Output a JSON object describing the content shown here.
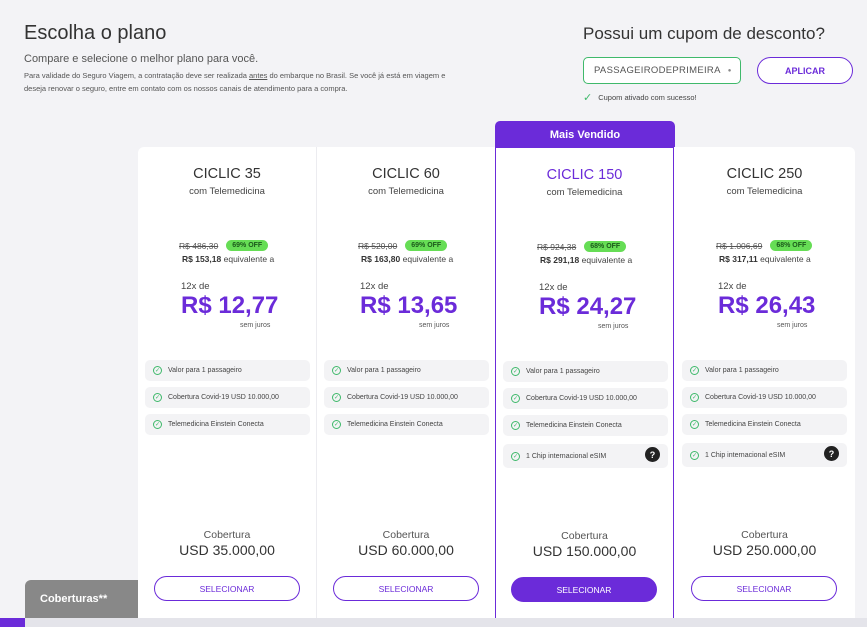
{
  "header": {
    "title": "Escolha o plano",
    "subtitle": "Compare e selecione o melhor plano para você.",
    "notice_pre": "Para validade do Seguro Viagem, a contratação deve ser realizada ",
    "notice_underlined": "antes",
    "notice_post": " do embarque no Brasil. Se você já está em viagem e deseja renovar o seguro, entre em contato com os nossos canais de atendimento para a compra."
  },
  "coupon": {
    "title": "Possui um cupom de desconto?",
    "code": "PASSAGEIRODEPRIMEIRA",
    "apply_label": "APLICAR",
    "success_text": "Cupom ativado com sucesso!"
  },
  "badge": "Mais Vendido",
  "plans": [
    {
      "name": "CICLIC 35",
      "sub": "com Telemedicina",
      "old_price": "R$ 486,30",
      "off": "69% OFF",
      "total": "R$ 153,18",
      "equiv": "equivalente a",
      "installments": "12x de",
      "installment_value": "R$ 12,77",
      "no_interest": "sem juros",
      "features": [
        "Valor para 1 passageiro",
        "Cobertura Covid-19 USD 10.000,00",
        "Telemedicina Einstein Conecta"
      ],
      "coverage_label": "Cobertura",
      "coverage_value": "USD 35.000,00",
      "select_label": "SELECIONAR"
    },
    {
      "name": "CICLIC 60",
      "sub": "com Telemedicina",
      "old_price": "R$ 520,00",
      "off": "69% OFF",
      "total": "R$ 163,80",
      "equiv": "equivalente a",
      "installments": "12x de",
      "installment_value": "R$ 13,65",
      "no_interest": "sem juros",
      "features": [
        "Valor para 1 passageiro",
        "Cobertura Covid-19 USD 10.000,00",
        "Telemedicina Einstein Conecta"
      ],
      "coverage_label": "Cobertura",
      "coverage_value": "USD 60.000,00",
      "select_label": "SELECIONAR"
    },
    {
      "name": "CICLIC 150",
      "sub": "com Telemedicina",
      "old_price": "R$ 924,38",
      "off": "68% OFF",
      "total": "R$ 291,18",
      "equiv": "equivalente a",
      "installments": "12x de",
      "installment_value": "R$ 24,27",
      "no_interest": "sem juros",
      "features": [
        "Valor para 1 passageiro",
        "Cobertura Covid-19 USD 10.000,00",
        "Telemedicina Einstein Conecta",
        "1 Chip internacional eSIM"
      ],
      "coverage_label": "Cobertura",
      "coverage_value": "USD 150.000,00",
      "select_label": "SELECIONAR"
    },
    {
      "name": "CICLIC 250",
      "sub": "com Telemedicina",
      "old_price": "R$ 1.006,69",
      "off": "68% OFF",
      "total": "R$ 317,11",
      "equiv": "equivalente a",
      "installments": "12x de",
      "installment_value": "R$ 26,43",
      "no_interest": "sem juros",
      "features": [
        "Valor para 1 passageiro",
        "Cobertura Covid-19 USD 10.000,00",
        "Telemedicina Einstein Conecta",
        "1 Chip internacional eSIM"
      ],
      "coverage_label": "Cobertura",
      "coverage_value": "USD 250.000,00",
      "select_label": "SELECIONAR"
    }
  ],
  "help_glyph": "?",
  "coverage_tab": "Coberturas**",
  "colors": {
    "accent": "#6b2bd9",
    "success": "#3fb96b",
    "discount_badge": "#66dd55"
  },
  "icons": {
    "check": "check-icon",
    "help": "help-icon",
    "chevron": "chevron-down-icon"
  }
}
